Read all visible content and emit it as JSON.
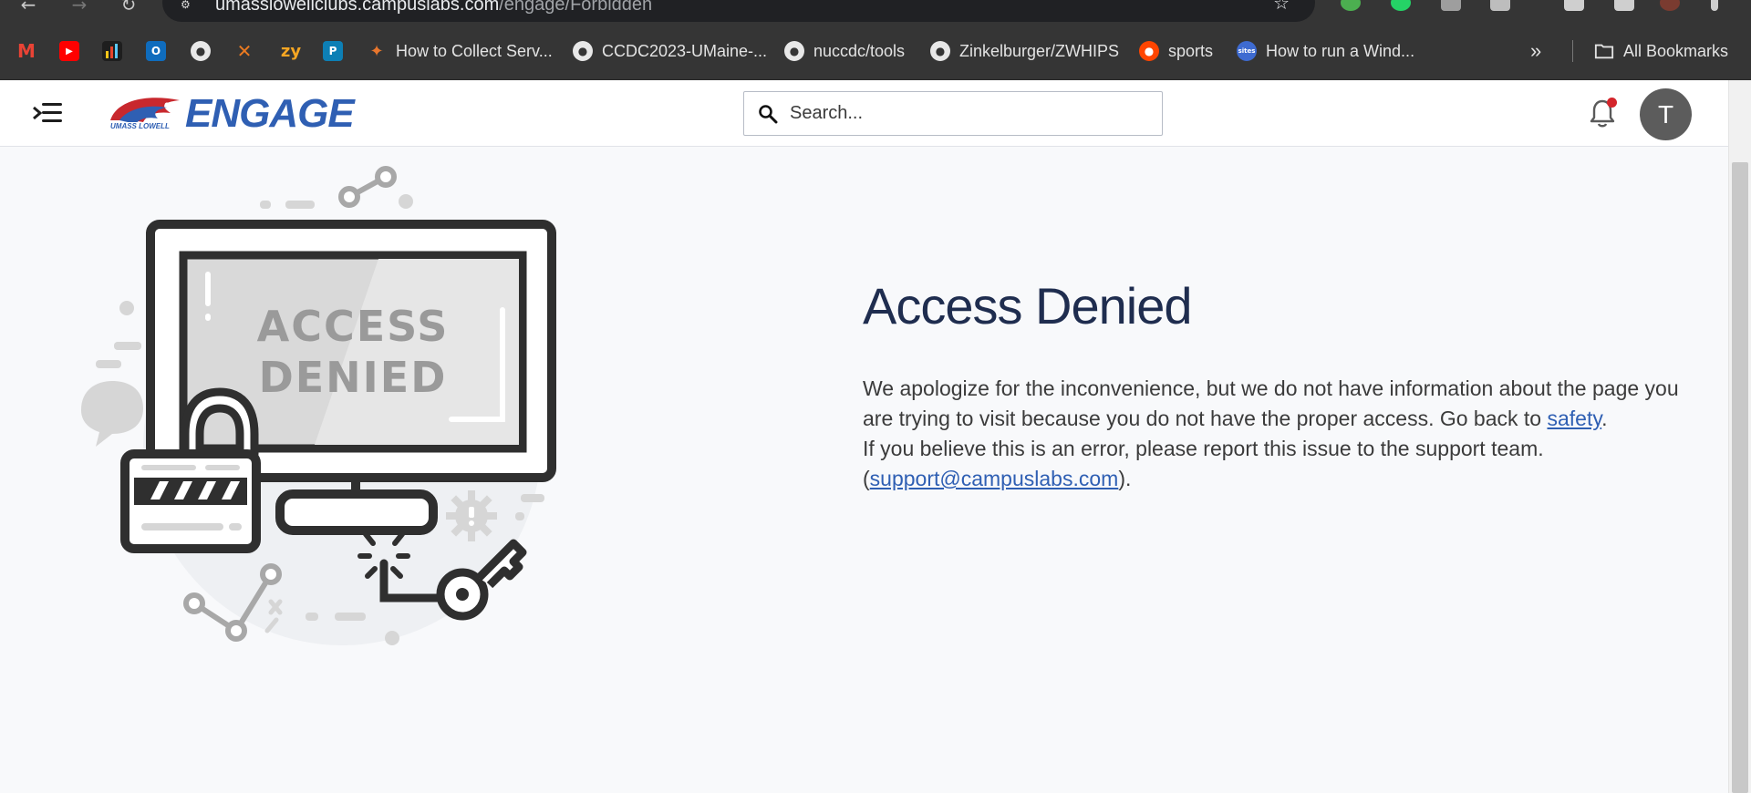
{
  "browser": {
    "url_host": "umasslowellclubs.campuslabs.com",
    "url_path": "/engage/Forbidden",
    "bookmarks": [
      {
        "label": "",
        "icon": "gmail-icon",
        "color": "#ea4335"
      },
      {
        "label": "",
        "icon": "youtube-icon",
        "color": "#ff0000"
      },
      {
        "label": "",
        "icon": "bar-chart-icon",
        "color": "#1e1e1e"
      },
      {
        "label": "",
        "icon": "outlook-icon",
        "color": "#0f6cbd"
      },
      {
        "label": "",
        "icon": "github-icon",
        "color": "#e8e8e8"
      },
      {
        "label": "",
        "icon": "x-mark-icon",
        "color": "#ea7a21"
      },
      {
        "label": "",
        "icon": "zybooks-icon",
        "color": "#f5a623"
      },
      {
        "label": "",
        "icon": "pearson-icon",
        "color": "#0d7fb5"
      },
      {
        "label": "How to Collect Serv...",
        "icon": "puzzle-icon",
        "color": "#e8762d"
      },
      {
        "label": "CCDC2023-UMaine-...",
        "icon": "github-icon",
        "color": "#e8e8e8"
      },
      {
        "label": "nuccdc/tools",
        "icon": "github-icon",
        "color": "#e8e8e8"
      },
      {
        "label": "Zinkelburger/ZWHIPS",
        "icon": "github-icon",
        "color": "#e8e8e8"
      },
      {
        "label": "sports",
        "icon": "reddit-icon",
        "color": "#ff4500"
      },
      {
        "label": "How to run a Wind...",
        "icon": "sites-icon",
        "color": "#3e6bd1"
      }
    ],
    "overflow_label": "»",
    "all_bookmarks_label": "All Bookmarks"
  },
  "header": {
    "logo_text": "ENGAGE",
    "logo_subtext": "UMASS LOWELL",
    "search_placeholder": "Search...",
    "avatar_initial": "T"
  },
  "illustration": {
    "screen_text_line1": "ACCESS",
    "screen_text_line2": "DENIED"
  },
  "main": {
    "title": "Access Denied",
    "line1": "We apologize for the inconvenience, but we do not have information about the page you are trying to visit because you do not have the proper access. Go back to ",
    "safety_link": "safety",
    "line1_end": ".",
    "line2": "If you believe this is an error, please report this issue to the support team.",
    "paren_open": "(",
    "support_email": "support@campuslabs.com",
    "paren_close": ")."
  },
  "colors": {
    "accent": "#2f5fb3",
    "title": "#1f2d4f",
    "notification_dot": "#d4252b"
  }
}
